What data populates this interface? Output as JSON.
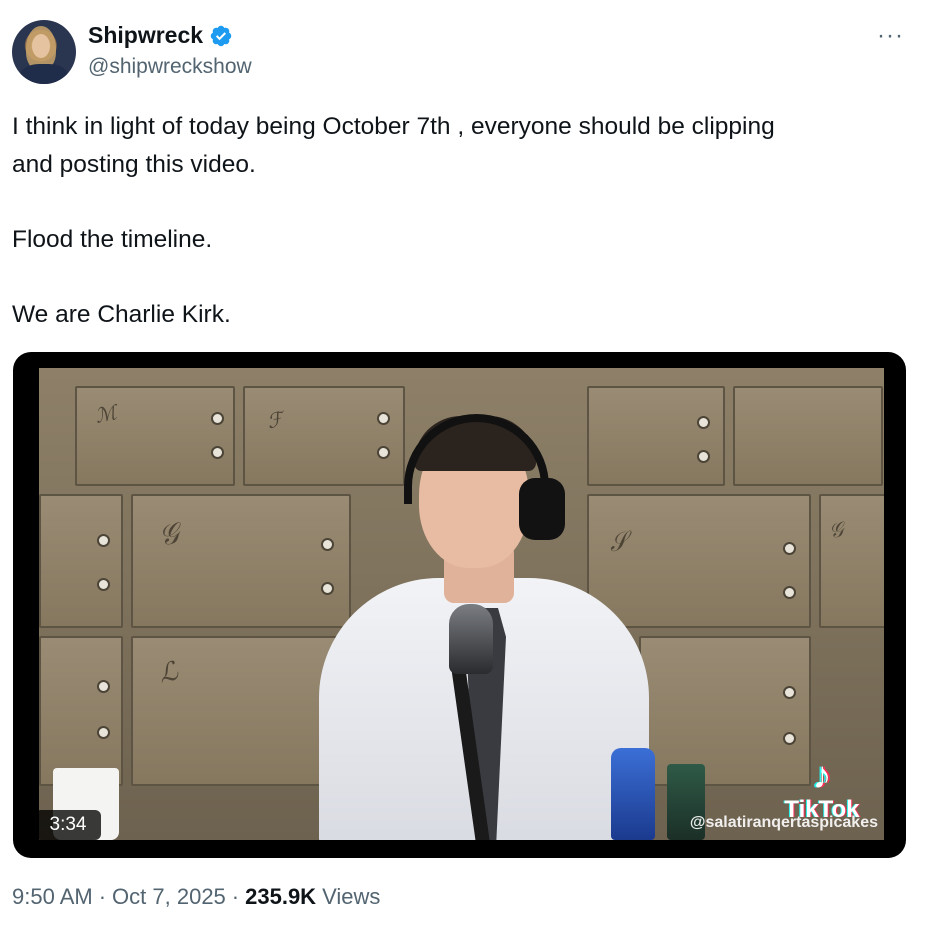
{
  "author": {
    "display_name": "Shipwreck",
    "handle": "@shipwreckshow",
    "verified_icon": "verified-badge-icon",
    "verified_color": "#1d9bf0"
  },
  "more_icon": "more-options-icon",
  "more_label": "···",
  "tweet": {
    "text": "I think in light of today being October 7th , everyone should be clipping\nand posting this video.\n\nFlood the timeline.\n\nWe are Charlie Kirk."
  },
  "media": {
    "duration": "3:34",
    "watermark_brand": "TikTok",
    "watermark_user": "@salatiranqertaspicakes",
    "tiktok_icon": "tiktok-note-icon",
    "tiktok_glyph": "♪"
  },
  "meta": {
    "time": "9:50 AM",
    "sep1": "·",
    "date": "Oct 7, 2025",
    "sep2": "·",
    "views_count": "235.9K",
    "views_label": "Views"
  },
  "colors": {
    "text_primary": "#0f1419",
    "text_secondary": "#536471",
    "accent": "#1d9bf0"
  }
}
